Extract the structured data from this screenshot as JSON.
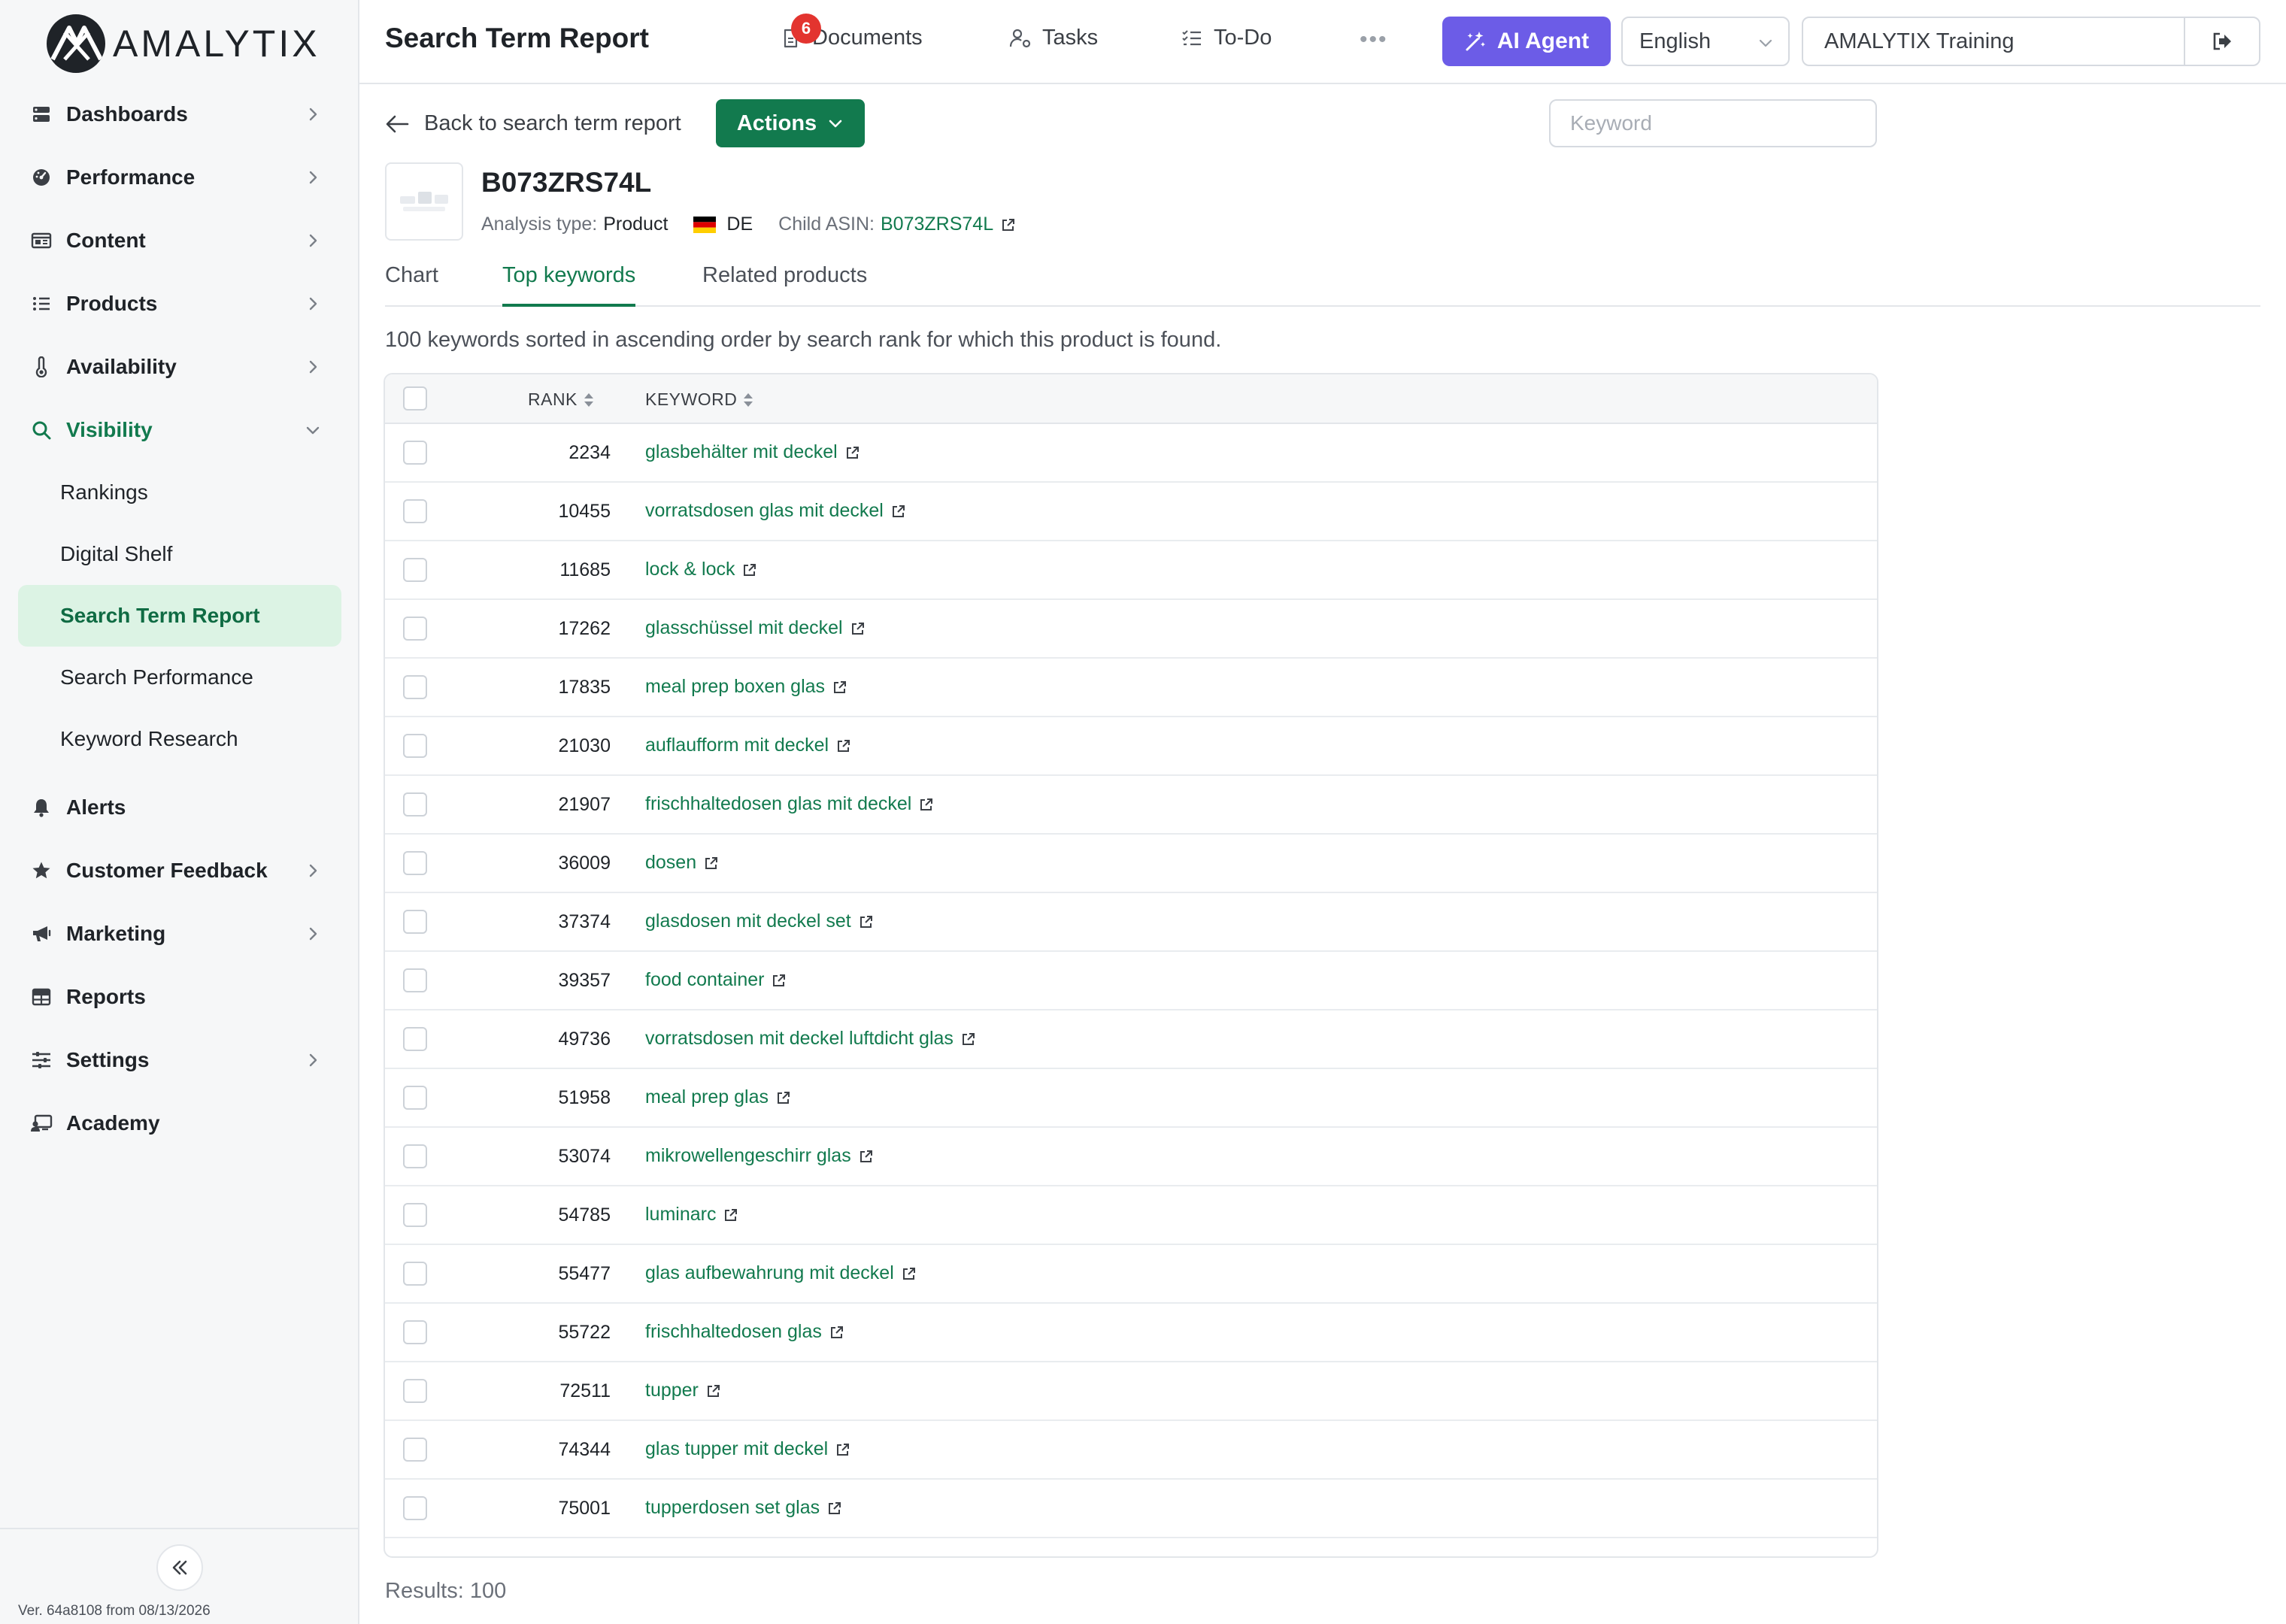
{
  "app": {
    "logo_text": "AMALYTIX",
    "version": "Ver. 64a8108 from 08/13/2026"
  },
  "sidebar": {
    "items": [
      {
        "label": "Dashboards",
        "icon": "dashboard-icon",
        "has_chevron": true
      },
      {
        "label": "Performance",
        "icon": "gauge-icon",
        "has_chevron": true
      },
      {
        "label": "Content",
        "icon": "content-icon",
        "has_chevron": true
      },
      {
        "label": "Products",
        "icon": "list-icon",
        "has_chevron": true
      },
      {
        "label": "Availability",
        "icon": "thermometer-icon",
        "has_chevron": true
      },
      {
        "label": "Visibility",
        "icon": "search-icon",
        "expanded": true
      }
    ],
    "visibility_sub": [
      "Rankings",
      "Digital Shelf",
      "Search Term Report",
      "Search Performance",
      "Keyword Research"
    ],
    "current_sub": "Search Term Report",
    "items_after": [
      {
        "label": "Alerts",
        "icon": "bell-icon",
        "has_chevron": false
      },
      {
        "label": "Customer Feedback",
        "icon": "star-icon",
        "has_chevron": true
      },
      {
        "label": "Marketing",
        "icon": "megaphone-icon",
        "has_chevron": true
      },
      {
        "label": "Reports",
        "icon": "table-icon",
        "has_chevron": false
      },
      {
        "label": "Settings",
        "icon": "sliders-icon",
        "has_chevron": true
      },
      {
        "label": "Academy",
        "icon": "academy-icon",
        "has_chevron": false
      }
    ]
  },
  "topbar": {
    "title": "Search Term Report",
    "documents_label": "Documents",
    "documents_badge": "6",
    "tasks_label": "Tasks",
    "todo_label": "To-Do",
    "ai_agent_label": "AI Agent",
    "language": "English",
    "account": "AMALYTIX Training"
  },
  "main": {
    "back_label": "Back to search term report",
    "actions_label": "Actions",
    "keyword_placeholder": "Keyword",
    "asin": "B073ZRS74L",
    "analysis_type_label": "Analysis type:",
    "analysis_type": "Product",
    "country": "DE",
    "child_asin_label": "Child ASIN:",
    "child_asin": "B073ZRS74L",
    "tabs": [
      "Chart",
      "Top keywords",
      "Related products"
    ],
    "active_tab": "Top keywords",
    "summary": "100 keywords sorted in ascending order by search rank for which this product is found.",
    "results": "Results: 100"
  },
  "table": {
    "headers": {
      "rank": "RANK",
      "keyword": "KEYWORD"
    },
    "rows": [
      {
        "rank": "2234",
        "keyword": "glasbehälter mit deckel"
      },
      {
        "rank": "10455",
        "keyword": "vorratsdosen glas mit deckel"
      },
      {
        "rank": "11685",
        "keyword": "lock & lock"
      },
      {
        "rank": "17262",
        "keyword": "glasschüssel mit deckel"
      },
      {
        "rank": "17835",
        "keyword": "meal prep boxen glas"
      },
      {
        "rank": "21030",
        "keyword": "auflaufform mit deckel"
      },
      {
        "rank": "21907",
        "keyword": "frischhaltedosen glas mit deckel"
      },
      {
        "rank": "36009",
        "keyword": "dosen"
      },
      {
        "rank": "37374",
        "keyword": "glasdosen mit deckel set"
      },
      {
        "rank": "39357",
        "keyword": "food container"
      },
      {
        "rank": "49736",
        "keyword": "vorratsdosen mit deckel luftdicht glas"
      },
      {
        "rank": "51958",
        "keyword": "meal prep glas"
      },
      {
        "rank": "53074",
        "keyword": "mikrowellengeschirr glas"
      },
      {
        "rank": "54785",
        "keyword": "luminarc"
      },
      {
        "rank": "55477",
        "keyword": "glas aufbewahrung mit deckel"
      },
      {
        "rank": "55722",
        "keyword": "frischhaltedosen glas"
      },
      {
        "rank": "72511",
        "keyword": "tupper"
      },
      {
        "rank": "74344",
        "keyword": "glas tupper mit deckel"
      },
      {
        "rank": "75001",
        "keyword": "tupperdosen set glas"
      }
    ]
  },
  "colors": {
    "brand_green": "#127a4e",
    "ai_purple": "#6c5ce7",
    "active_bg": "#dcf3e4",
    "badge_red": "#e3342f"
  }
}
